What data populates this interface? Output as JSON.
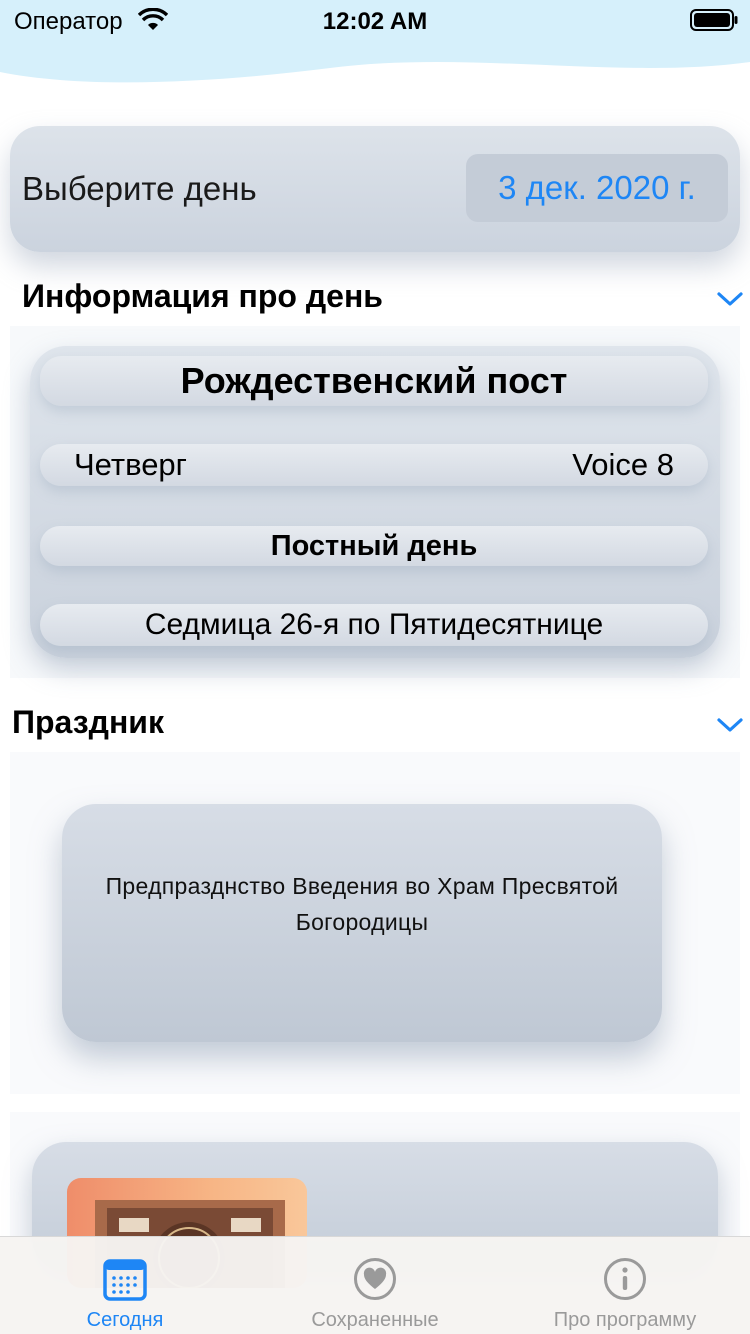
{
  "status_bar": {
    "carrier": "Оператор",
    "time": "12:02 AM"
  },
  "date_picker": {
    "label": "Выберите день",
    "value": "3 дек. 2020 г."
  },
  "day_info": {
    "section_title": "Информация про день",
    "fast_name": "Рождественский пост",
    "weekday": "Четверг",
    "voice": "Voice 8",
    "fast_type": "Постный день",
    "week": "Седмица 26-я по Пятидесятнице"
  },
  "holiday": {
    "section_title": "Праздник",
    "text": "Предпразднство Введения во Храм Пресвятой Богородицы"
  },
  "tabs": [
    {
      "label": "Сегодня",
      "icon": "calendar-icon",
      "active": true
    },
    {
      "label": "Сохраненные",
      "icon": "heart-icon",
      "active": false
    },
    {
      "label": "Про программу",
      "icon": "info-icon",
      "active": false
    }
  ],
  "colors": {
    "accent": "#1e86f5",
    "inactive": "#9a9a9a",
    "wave": "#d6f0fb"
  }
}
